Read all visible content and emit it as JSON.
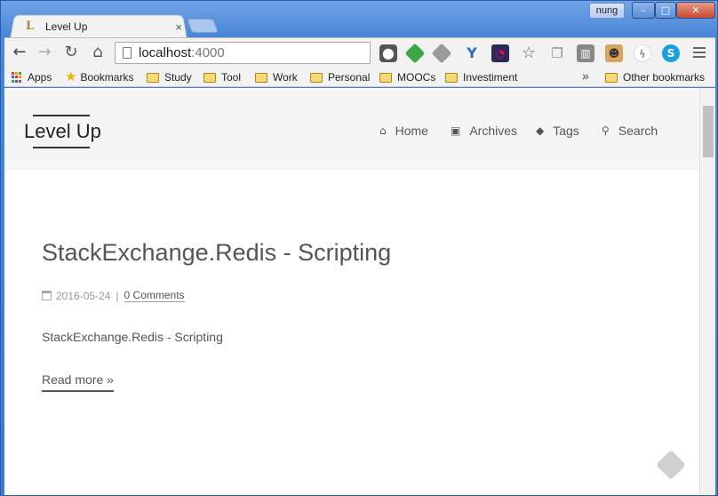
{
  "browser": {
    "tab_title": "Level Up",
    "tab_close": "×",
    "user": "nung",
    "window_controls": {
      "minimize": "–",
      "maximize": "□",
      "close": "✕"
    },
    "nav_icons": {
      "back": "←",
      "forward": "→",
      "reload": "↻",
      "home": "⌂"
    },
    "url_host": "localhost",
    "url_port": ":4000",
    "extensions": [
      "pocket-icon",
      "feedly-icon",
      "feedly-gray-icon",
      "yoast-icon",
      "speed-dial-icon",
      "bookmark-star-icon",
      "copy-icon",
      "trello-icon",
      "gitlab-icon",
      "flash-icon",
      "skype-icon"
    ],
    "bookmarks": [
      "Apps",
      "Bookmarks",
      "Study",
      "Tool",
      "Work",
      "Personal",
      "MOOCs",
      "Investiment"
    ],
    "bookmarks_overflow": "»",
    "other_bookmarks": "Other bookmarks"
  },
  "site": {
    "logo": "Level Up",
    "nav": [
      {
        "label": "Home",
        "icon": "home-icon"
      },
      {
        "label": "Archives",
        "icon": "archive-icon"
      },
      {
        "label": "Tags",
        "icon": "tags-icon"
      },
      {
        "label": "Search",
        "icon": "search-icon"
      }
    ]
  },
  "post": {
    "title": "StackExchange.Redis - Scripting",
    "date": "2016-05-24",
    "separator": "|",
    "comments": "0 Comments",
    "excerpt": "StackExchange.Redis - Scripting",
    "read_more": "Read more »"
  }
}
